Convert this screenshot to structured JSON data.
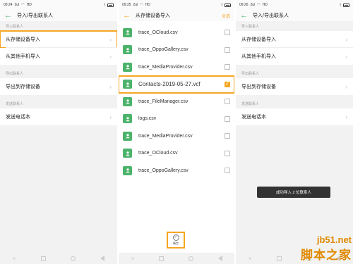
{
  "panel1": {
    "status": {
      "time": "09:24",
      "signal": "2ul",
      "network": "HD"
    },
    "title": "导入/导出联系人",
    "sections": [
      {
        "label": "导入联系人",
        "items": [
          "从存储设备导入",
          "从其他手机导入"
        ]
      },
      {
        "label": "导出联系人",
        "items": [
          "导出到存储设备"
        ]
      },
      {
        "label": "发送联系人",
        "items": [
          "发送电话本"
        ]
      }
    ]
  },
  "panel2": {
    "status": {
      "time": "09:25",
      "signal": "2ul",
      "network": "HD"
    },
    "title": "从存储设备导入",
    "select_all": "全选",
    "files": [
      {
        "name": "trace_OCloud.csv",
        "checked": false
      },
      {
        "name": "trace_OppoGallery.csv",
        "checked": false
      },
      {
        "name": "trace_MediaProvider.csv",
        "checked": false
      },
      {
        "name": "Contacts-2019-05-27.vcf",
        "checked": true
      },
      {
        "name": "trace_FileManager.csv",
        "checked": false
      },
      {
        "name": "logs.csv",
        "checked": false
      },
      {
        "name": "trace_MediaProvider.csv",
        "checked": false
      },
      {
        "name": "trace_OCloud.csv",
        "checked": false
      },
      {
        "name": "trace_OppoGallery.csv",
        "checked": false
      }
    ],
    "confirm_label": "确定"
  },
  "panel3": {
    "status": {
      "time": "09:26",
      "signal": "2ul",
      "network": "HD"
    },
    "title": "导入/导出联系人",
    "sections": [
      {
        "label": "导入联系人",
        "items": [
          "从存储设备导入",
          "从其他手机导入"
        ]
      },
      {
        "label": "导出联系人",
        "items": [
          "导出到存储设备"
        ]
      },
      {
        "label": "发送联系人",
        "items": [
          "发送电话本"
        ]
      }
    ],
    "toast": "成功导入 2 位联系人"
  },
  "watermark": {
    "line1": "jb51.net",
    "line2": "脚本之家"
  },
  "colors": {
    "accent_green": "#4cb36b",
    "accent_orange": "#f5a623"
  },
  "icons": {
    "back": "back-arrow-icon",
    "chevron": "chevron-right-icon",
    "contact": "contact-card-icon",
    "check": "check-icon"
  }
}
